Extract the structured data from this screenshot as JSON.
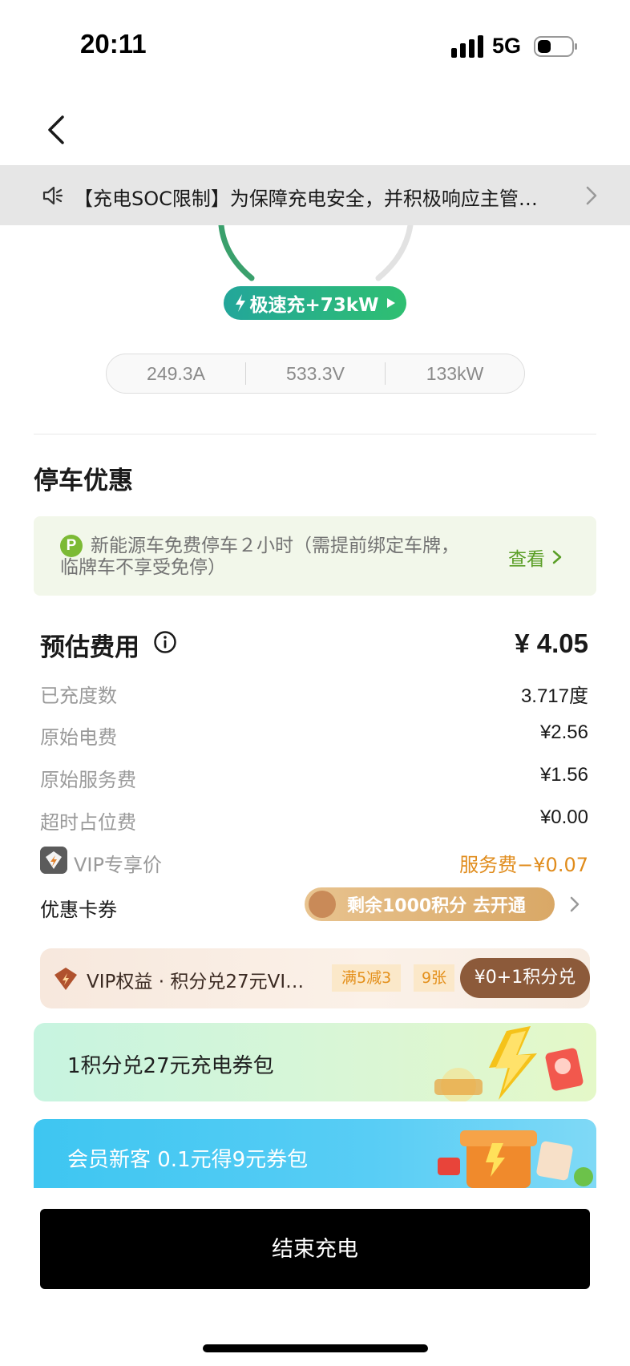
{
  "status_bar": {
    "time": "20:11",
    "network": "5G"
  },
  "notice": {
    "text": "【充电SOC限制】为保障充电安全，并积极响应主管…"
  },
  "charging": {
    "badge_label": "极速充+73kW",
    "metrics": [
      "249.3A",
      "533.3V",
      "133kW"
    ],
    "colors": {
      "badge_start": "#23a69a",
      "badge_end": "#2fbf71",
      "arc": "#3aa06c"
    }
  },
  "parking": {
    "title": "停车优惠",
    "icon_letter": "P",
    "text": "新能源车免费停车２小时（需提前绑定车牌，临牌车不享受免停）",
    "link": "查看"
  },
  "fee": {
    "title": "预估费用",
    "total": "¥ 4.05",
    "rows": [
      {
        "label": "已充度数",
        "value": "3.717度"
      },
      {
        "label": "原始电费",
        "value": "¥2.56"
      },
      {
        "label": "原始服务费",
        "value": "¥1.56"
      },
      {
        "label": "超时占位费",
        "value": "¥0.00"
      }
    ],
    "vip": {
      "label": "VIP专享价",
      "value": "服务费−¥0.07",
      "color": "#e08c1c"
    },
    "coupon": {
      "label": "优惠卡券",
      "pill": "剩余1000积分 去开通"
    }
  },
  "promos": {
    "vip_banner": {
      "title": "VIP权益 · 积分兑27元VI…",
      "tag1": "满5减3",
      "tag2": "9张",
      "cta": "¥0+1积分兑"
    },
    "card1": {
      "title": "1积分兑27元充电券包"
    },
    "card2": {
      "title": "会员新客 0.1元得9元券包"
    }
  },
  "actions": {
    "stop_label": "结束充电"
  }
}
